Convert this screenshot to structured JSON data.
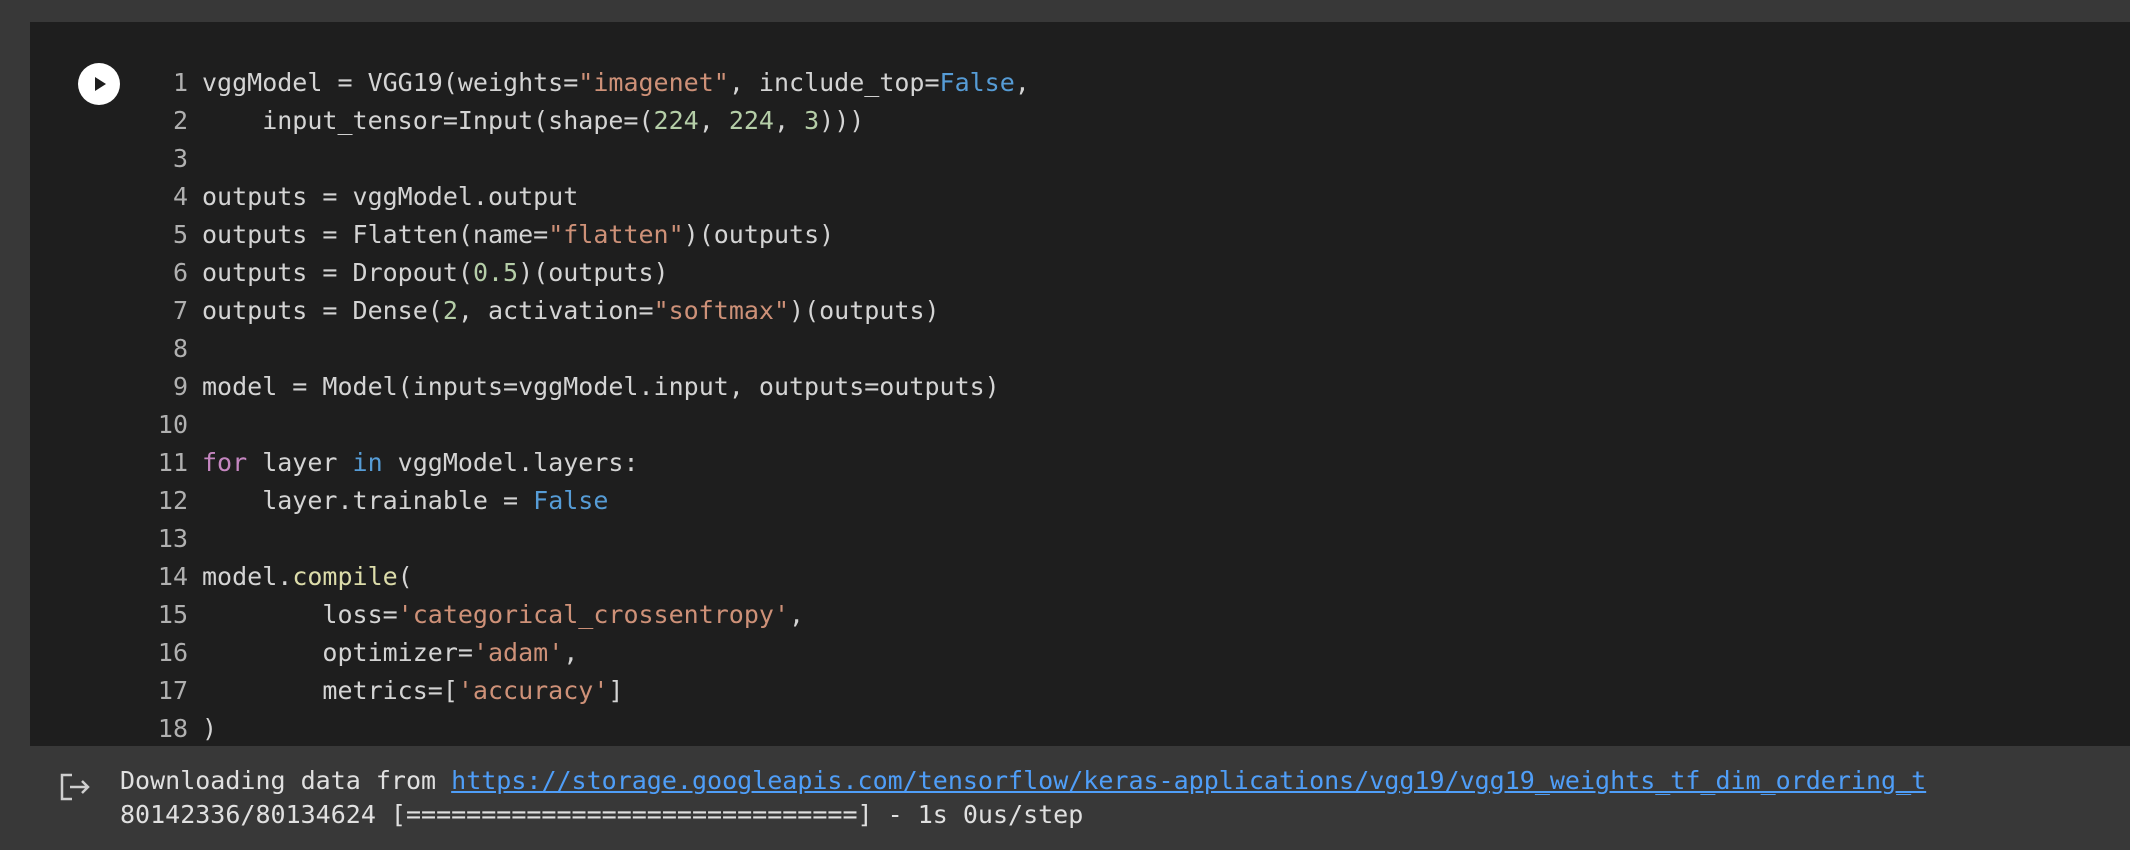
{
  "cell": {
    "run_button_icon": "play-icon",
    "code_lines": [
      [
        {
          "t": "vggModel = VGG19(weights="
        },
        {
          "t": "\"imagenet\"",
          "c": "str"
        },
        {
          "t": ", include_top="
        },
        {
          "t": "False",
          "c": "kw"
        },
        {
          "t": ","
        }
      ],
      [
        {
          "t": "    input_tensor=Input(shape=("
        },
        {
          "t": "224",
          "c": "num"
        },
        {
          "t": ", "
        },
        {
          "t": "224",
          "c": "num"
        },
        {
          "t": ", "
        },
        {
          "t": "3",
          "c": "num"
        },
        {
          "t": ")))"
        }
      ],
      [],
      [
        {
          "t": "outputs = vggModel.output"
        }
      ],
      [
        {
          "t": "outputs = Flatten(name="
        },
        {
          "t": "\"flatten\"",
          "c": "str"
        },
        {
          "t": ")(outputs)"
        }
      ],
      [
        {
          "t": "outputs = Dropout("
        },
        {
          "t": "0.5",
          "c": "num"
        },
        {
          "t": ")(outputs)"
        }
      ],
      [
        {
          "t": "outputs = Dense("
        },
        {
          "t": "2",
          "c": "num"
        },
        {
          "t": ", activation="
        },
        {
          "t": "\"softmax\"",
          "c": "str"
        },
        {
          "t": ")(outputs)"
        }
      ],
      [],
      [
        {
          "t": "model = Model(inputs=vggModel.input, outputs=outputs)"
        }
      ],
      [],
      [
        {
          "t": "for",
          "c": "ctl"
        },
        {
          "t": " layer "
        },
        {
          "t": "in",
          "c": "kw"
        },
        {
          "t": " vggModel.layers:"
        }
      ],
      [
        {
          "t": "    layer.trainable = "
        },
        {
          "t": "False",
          "c": "kw"
        }
      ],
      [],
      [
        {
          "t": "model."
        },
        {
          "t": "compile",
          "c": "fn"
        },
        {
          "t": "("
        }
      ],
      [
        {
          "t": "        loss="
        },
        {
          "t": "'categorical_crossentropy'",
          "c": "str"
        },
        {
          "t": ","
        }
      ],
      [
        {
          "t": "        optimizer="
        },
        {
          "t": "'adam'",
          "c": "str"
        },
        {
          "t": ","
        }
      ],
      [
        {
          "t": "        metrics=["
        },
        {
          "t": "'accuracy'",
          "c": "str"
        },
        {
          "t": "]"
        }
      ],
      [
        {
          "t": ")"
        }
      ]
    ]
  },
  "output": {
    "icon": "output-redirect-icon",
    "download_prefix": "Downloading data from ",
    "download_url": "https://storage.googleapis.com/tensorflow/keras-applications/vgg19/vgg19_weights_tf_dim_ordering_t",
    "progress_line": "80142336/80134624 [==============================] - 1s 0us/step"
  }
}
